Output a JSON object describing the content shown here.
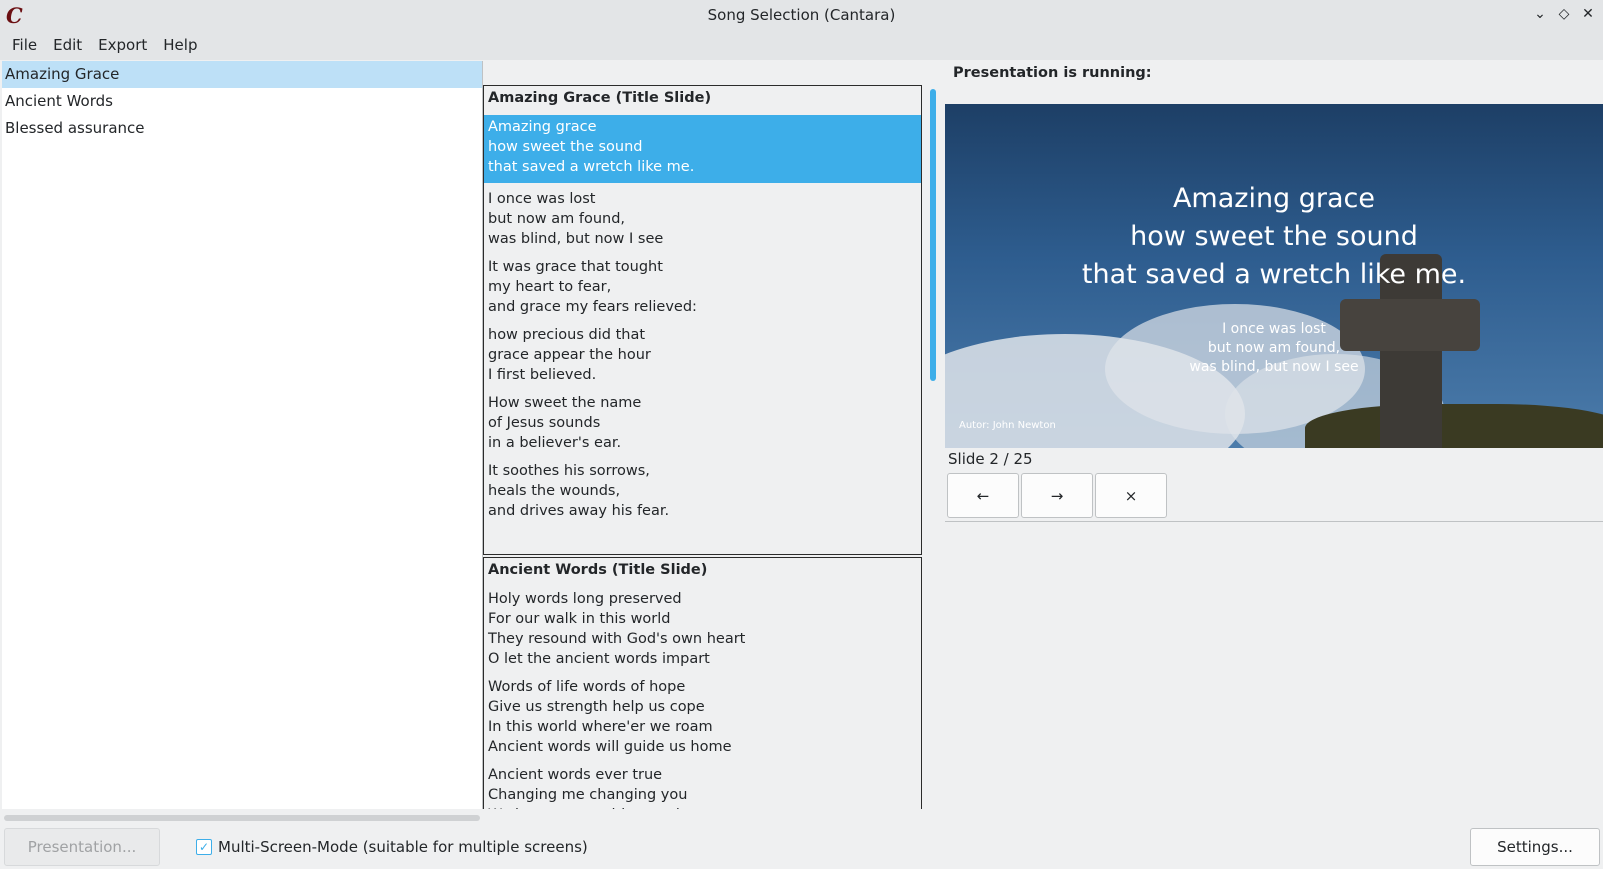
{
  "window": {
    "title": "Song Selection (Cantara)",
    "logo_glyph": "C"
  },
  "window_controls": {
    "minimize": "⌄",
    "maximize": "◇",
    "close": "✕"
  },
  "menu": [
    "File",
    "Edit",
    "Export",
    "Help"
  ],
  "songs": [
    "Amazing Grace",
    "Ancient Words",
    "Blessed assurance"
  ],
  "selected_song": "Amazing Grace",
  "slides_panel": {
    "blocks": [
      {
        "title": "Amazing Grace (Title Slide)",
        "slides": [
          "Amazing grace\nhow sweet the sound\nthat saved a wretch like me.",
          "I once was lost\nbut now am found,\nwas blind, but now I see",
          "It was grace that tought\nmy heart to fear,\nand grace my fears relieved:",
          "how precious did that\ngrace appear the hour\nI first believed.",
          "How sweet the name\nof Jesus sounds\nin a believer's ear.",
          "It soothes his sorrows,\nheals the wounds,\nand drives away his fear."
        ]
      },
      {
        "title": "Ancient Words (Title Slide)",
        "slides": [
          "Holy words long preserved\nFor our walk in this world\nThey resound with God's own heart\nO let the ancient words impart",
          "Words of life words of hope\nGive us strength help us cope\nIn this world where'er we roam\nAncient words will guide us home",
          "Ancient words ever true\nChanging me changing you\nWe have come with open hearts"
        ]
      }
    ]
  },
  "presentation": {
    "running_label": "Presentation is running:",
    "main_text": "Amazing grace\nhow sweet the sound\nthat saved a wretch like me.",
    "next_text": "I once was lost\nbut now am found,\nwas blind, but now I see",
    "author": "Autor: John Newton",
    "slide_counter": "Slide 2 / 25",
    "nav": {
      "prev": "←",
      "next": "→",
      "close": "×"
    }
  },
  "bottom": {
    "presentation_button": "Presentation...",
    "multi_screen_label": "Multi-Screen-Mode (suitable for multiple screens)",
    "multi_screen_checked": true,
    "settings_button": "Settings..."
  },
  "colors": {
    "accent": "#3daee9",
    "selection_light": "#bde0f7",
    "logo": "#6b0f12"
  }
}
